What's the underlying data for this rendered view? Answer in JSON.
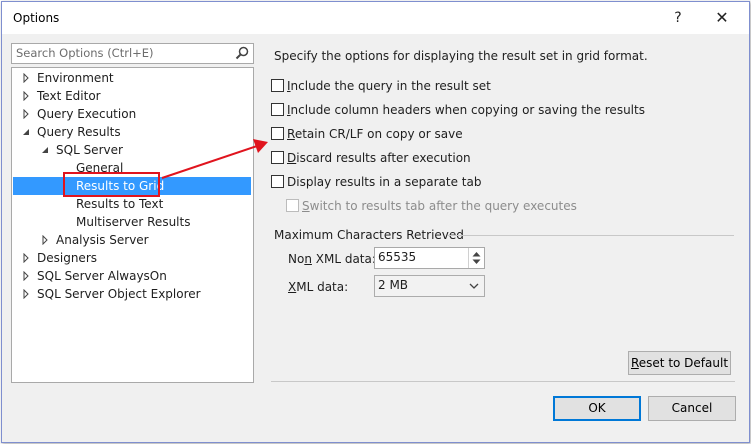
{
  "window": {
    "title": "Options",
    "help_glyph": "?",
    "close_glyph": "✕"
  },
  "search": {
    "placeholder": "Search Options (Ctrl+E)"
  },
  "tree": [
    {
      "label": "Environment",
      "expander": "collapsed"
    },
    {
      "label": "Text Editor",
      "expander": "collapsed"
    },
    {
      "label": "Query Execution",
      "expander": "collapsed"
    },
    {
      "label": "Query Results",
      "expander": "expanded"
    },
    {
      "label": "SQL Server",
      "expander": "expanded"
    },
    {
      "label": "General",
      "expander": "none"
    },
    {
      "label": "Results to Grid",
      "expander": "none",
      "selected": true
    },
    {
      "label": "Results to Text",
      "expander": "none"
    },
    {
      "label": "Multiserver Results",
      "expander": "none"
    },
    {
      "label": "Analysis Server",
      "expander": "collapsed"
    },
    {
      "label": "Designers",
      "expander": "collapsed"
    },
    {
      "label": "SQL Server AlwaysOn",
      "expander": "collapsed"
    },
    {
      "label": "SQL Server Object Explorer",
      "expander": "collapsed"
    }
  ],
  "description": "Specify the options for displaying the result set in grid format.",
  "options": [
    {
      "mnemonic": "I",
      "rest": "nclude the query in the result set",
      "checked": false,
      "enabled": true
    },
    {
      "mnemonic": "I",
      "rest": "nclude column headers when copying or saving the results",
      "checked": false,
      "enabled": true
    },
    {
      "mnemonic": "R",
      "rest": "etain CR/LF on copy or save",
      "checked": false,
      "enabled": true
    },
    {
      "mnemonic": "D",
      "rest": "iscard results after execution",
      "checked": false,
      "enabled": true
    },
    {
      "mnemonic": "",
      "rest": "Display results in a separate tab",
      "checked": false,
      "enabled": true
    },
    {
      "mnemonic": "S",
      "rest": "witch to results tab after the query executes",
      "checked": false,
      "enabled": false
    }
  ],
  "max_chars": {
    "title": "Maximum Characters Retrieved",
    "non_xml_pre": "No",
    "non_xml_mn": "n",
    "non_xml_post": " XML data:",
    "non_xml_value": "65535",
    "xml_mn": "X",
    "xml_post": "ML data:",
    "xml_value": "2 MB"
  },
  "buttons": {
    "reset_mn": "R",
    "reset_rest": "eset to Default",
    "ok": "OK",
    "cancel": "Cancel"
  },
  "colors": {
    "selection": "#3399ff",
    "annotation": "#e0141e",
    "primary_border": "#0078d7"
  }
}
